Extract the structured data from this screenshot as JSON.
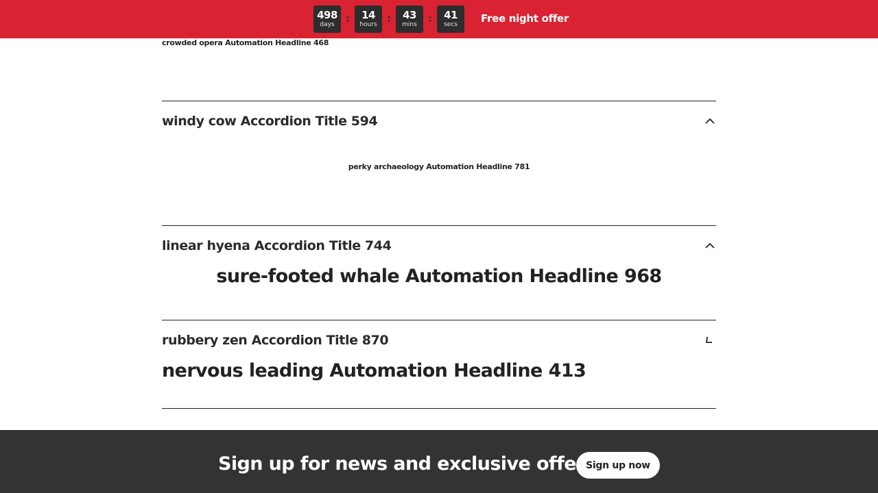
{
  "countdown": {
    "days": {
      "value": "498",
      "label": "days"
    },
    "hours": {
      "value": "14",
      "label": "hours"
    },
    "mins": {
      "value": "43",
      "label": "mins"
    },
    "secs": {
      "value": "41",
      "label": "secs"
    },
    "separator": ":"
  },
  "offer_text": "Free night offer",
  "top_headline": "crowded opera Automation Headline 468",
  "accordions": [
    {
      "title": "windy cow Accordion Title 594",
      "body": "perky archaeology Automation Headline 781",
      "icon": "chevron-up-icon"
    },
    {
      "title": "linear hyena Accordion Title 744",
      "body": "sure-footed whale Automation Headline 968",
      "icon": "chevron-up-icon"
    },
    {
      "title": "rubbery zen Accordion Title 870",
      "body": "nervous leading Automation Headline 413",
      "icon": "chevron-rotating-icon"
    }
  ],
  "footer": {
    "text": "Sign up for news and exclusive offers",
    "button": "Sign up now"
  },
  "colors": {
    "topbar": "#d92332",
    "footer": "#333333",
    "countdown_box": "#2d2d2d"
  }
}
